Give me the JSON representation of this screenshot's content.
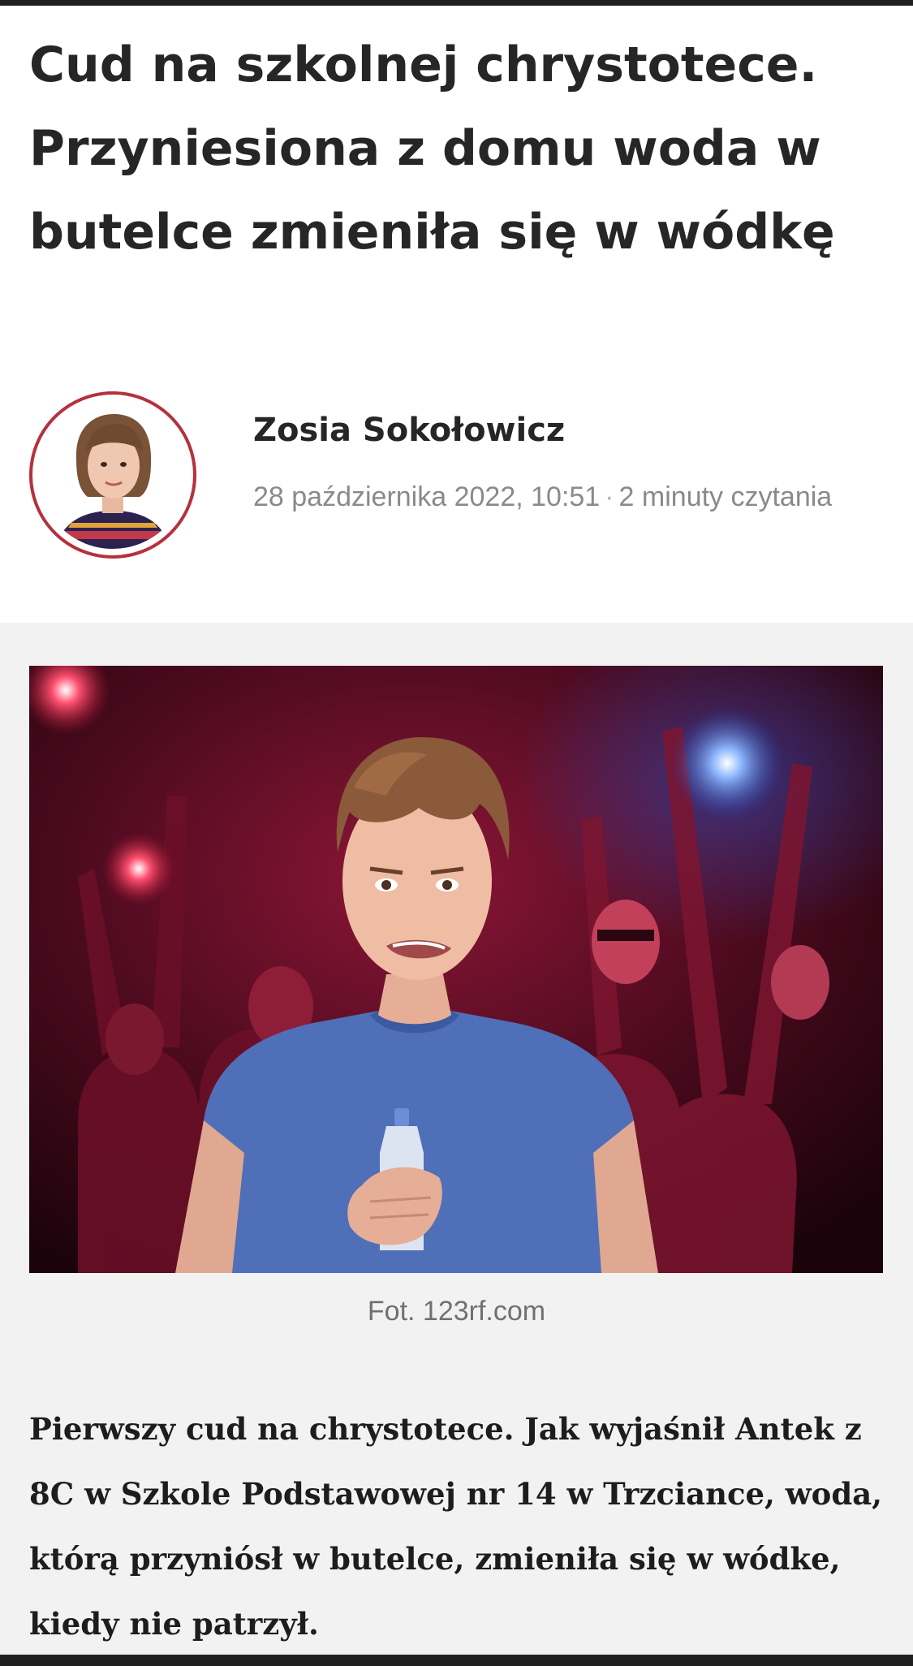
{
  "article": {
    "title": "Cud na szkolnej chrystotece. Przyniesiona z domu woda w butelce zmieniła się w wódkę",
    "author": {
      "name": "Zosia Sokołowicz",
      "avatar": "author-portrait-photo"
    },
    "meta": {
      "date": "28 października 2022, 10:51",
      "separator": "·",
      "reading_time": "2 minuty czytania"
    },
    "image": {
      "description_icon": "party-photo",
      "caption": "Fot. 123rf.com"
    },
    "body": "Pierwszy cud na chrystotece. Jak wyjaśnił Antek z 8C w Szkole Podstawowej nr 14 w Trzciance, woda, którą przyniósł w butelce, zmieniła się w wódke, kiedy nie patrzył."
  },
  "colors": {
    "accent_ring": "#b5313c",
    "title_text": "#262626",
    "meta_text": "#8a8a8a",
    "page_background": "#f2f2f2"
  }
}
